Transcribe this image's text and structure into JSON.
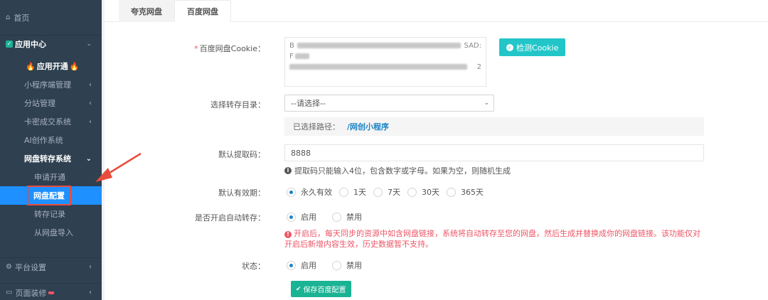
{
  "sidebar": {
    "home": "首页",
    "app_center": "应用中心",
    "items": [
      {
        "label": "应用开通",
        "style": "fire"
      },
      {
        "label": "小程序端管理",
        "chevron": "‹"
      },
      {
        "label": "分站管理",
        "chevron": "‹"
      },
      {
        "label": "卡密成交系统",
        "chevron": "‹"
      },
      {
        "label": "AI创作系统"
      },
      {
        "label": "网盘转存系统",
        "chevron": "⌄"
      }
    ],
    "sub_items": [
      "申请开通",
      "网盘配置",
      "转存记录",
      "从网盘导入"
    ],
    "platform": "平台设置",
    "decor": "页面装修"
  },
  "tabs": [
    "夸克网盘",
    "百度网盘"
  ],
  "form": {
    "cookie_label": "百度网盘Cookie：",
    "cookie_lines": [
      "B",
      "SAD:",
      "F",
      "2"
    ],
    "check_cookie": "检测Cookie",
    "dir_label": "选择转存目录：",
    "dir_placeholder": "--请选择--",
    "selected_path_label": "已选择路径：",
    "selected_path": "/网创小程序",
    "code_label": "默认提取码：",
    "code_value": "8888",
    "code_hint": "提取码只能输入4位，包含数字或字母。如果为空，则随机生成",
    "validity_label": "默认有效期：",
    "validity_options": [
      "永久有效",
      "1天",
      "7天",
      "30天",
      "365天"
    ],
    "auto_label": "是否开启自动转存：",
    "auto_options": [
      "启用",
      "禁用"
    ],
    "auto_warning": "开启后，每天同步的资源中如含网盘链接，系统将自动转存至您的网盘，然后生成并替换成你的网盘链接。该功能仅对开启后新增内容生效，历史数据暂不支持。",
    "status_label": "状态：",
    "status_options": [
      "启用",
      "禁用"
    ],
    "save_button": "保存百度配置"
  },
  "colors": {
    "sidebar_bg": "#2f4050",
    "active_item": "#1e90ff",
    "teal": "#23c6c8",
    "green": "#1ab394",
    "red": "#ed5565",
    "link": "#1c84c6"
  }
}
